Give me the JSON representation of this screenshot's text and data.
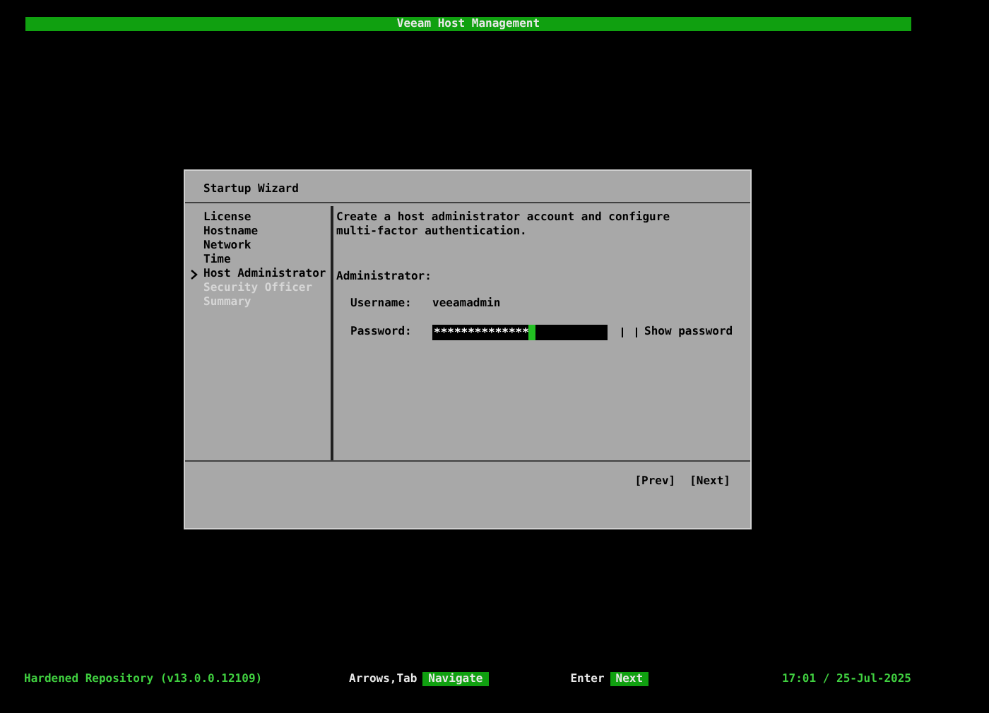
{
  "window": {
    "title": "Veeam Host Management"
  },
  "dialog": {
    "title": "Startup Wizard",
    "steps": [
      {
        "label": "License",
        "selected": false,
        "disabled": false
      },
      {
        "label": "Hostname",
        "selected": false,
        "disabled": false
      },
      {
        "label": "Network",
        "selected": false,
        "disabled": false
      },
      {
        "label": "Time",
        "selected": false,
        "disabled": false
      },
      {
        "label": "Host Administrator",
        "selected": true,
        "disabled": false
      },
      {
        "label": "Security Officer",
        "selected": false,
        "disabled": true
      },
      {
        "label": "Summary",
        "selected": false,
        "disabled": true
      }
    ],
    "description": "Create a host administrator account and configure multi-factor authentication.",
    "section": "Administrator:",
    "username": {
      "label": "Username:",
      "value": "veeamadmin"
    },
    "password": {
      "label": "Password:",
      "value": "**************",
      "focused": true
    },
    "show_password": {
      "label": "Show password",
      "checked": false
    },
    "buttons": [
      "[Prev]",
      "[Next]"
    ]
  },
  "status_bar": {
    "product": "Hardened Repository (v13.0.0.12109)",
    "hints": [
      {
        "keys": "Arrows,Tab",
        "action": "Navigate"
      },
      {
        "keys": "Enter",
        "action": "Next"
      }
    ],
    "datetime": "17:01 / 25-Jul-2025"
  }
}
